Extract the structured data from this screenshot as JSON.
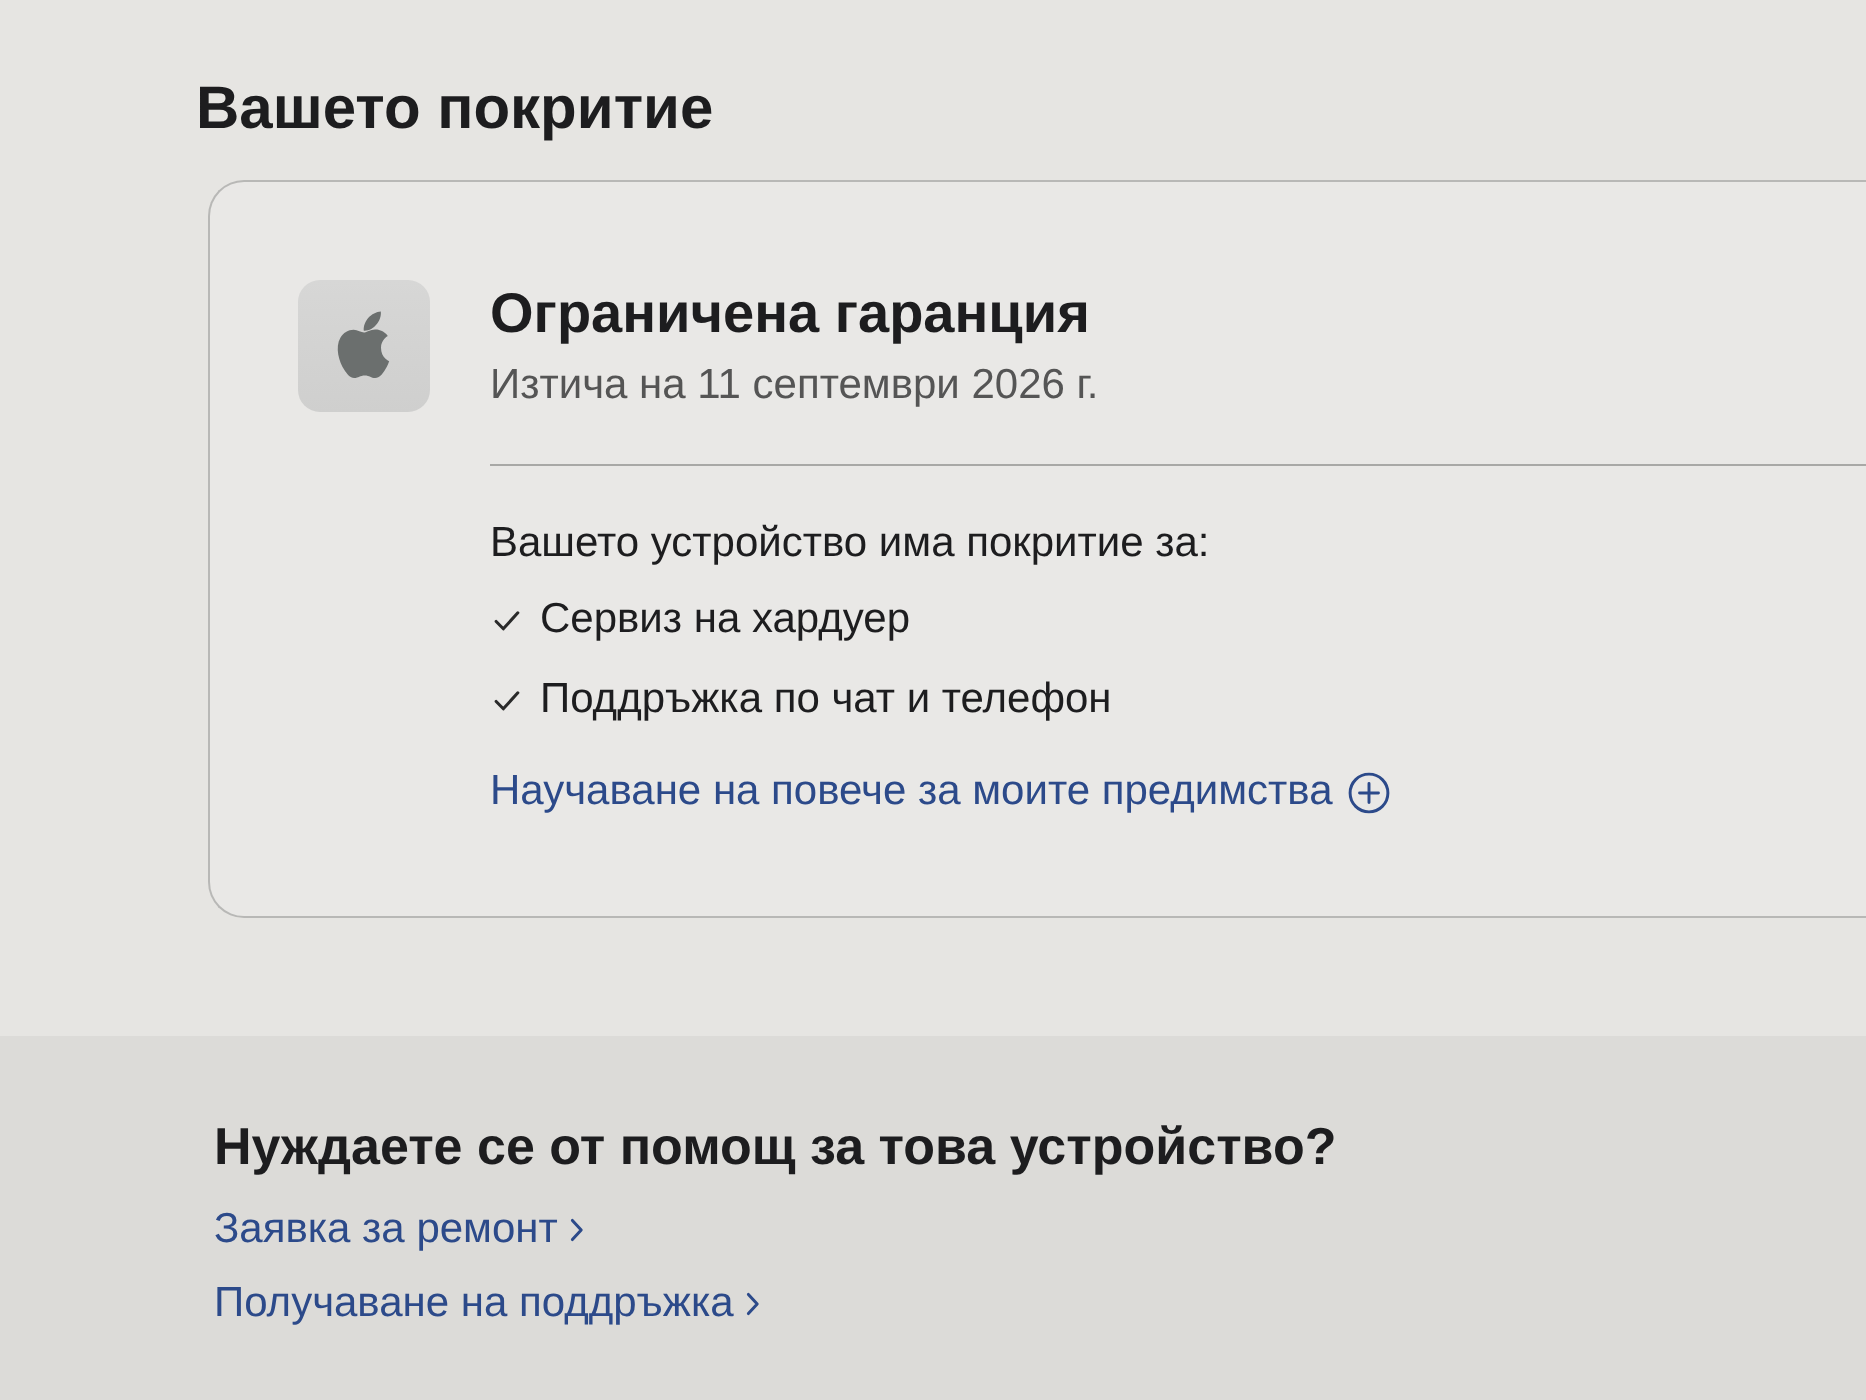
{
  "coverage": {
    "title": "Вашето покритие",
    "card": {
      "title": "Ограничена гаранция",
      "expiry": "Изтича на 11 септември 2026 г.",
      "intro": "Вашето устройство има покритие за:",
      "items": [
        "Сервиз на хардуер",
        "Поддръжка по чат и телефон"
      ],
      "link": "Научаване на повече за моите предимства"
    }
  },
  "help": {
    "title": "Нуждаете се от помощ за това устройство?",
    "links": [
      "Заявка за ремонт",
      "Получаване на поддръжка"
    ]
  }
}
